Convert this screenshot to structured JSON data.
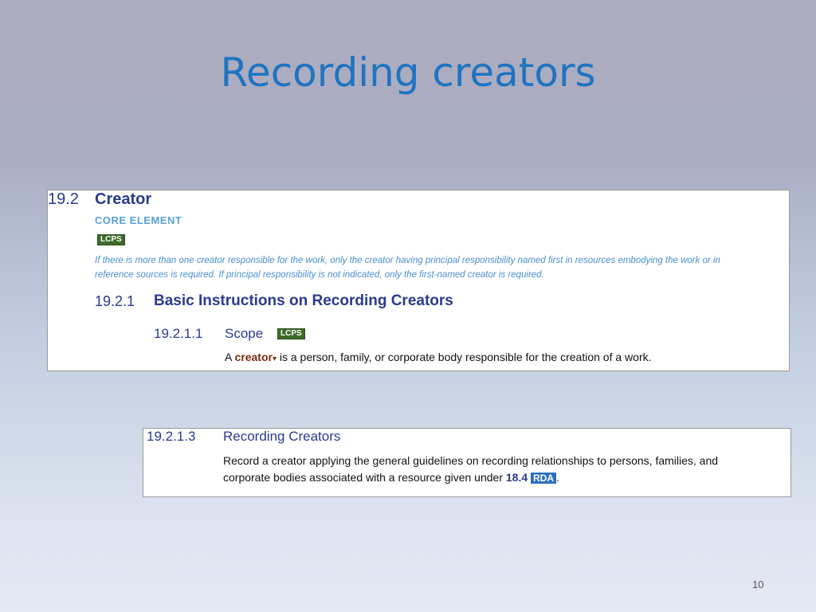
{
  "slide": {
    "title": "Recording creators",
    "number": "10"
  },
  "panel1": {
    "section_num": "19.2",
    "section_title": "Creator",
    "core_label": "CORE ELEMENT",
    "lcps_badge": "LCPS",
    "note_line1": "If there is more than one creator responsible for the work, only the creator having principal responsibility named first in resources embodying the work or in",
    "note_line2": "reference sources is required. If principal responsibility is not indicated, only the first-named creator is required.",
    "sub_num": "19.2.1",
    "sub_title": "Basic Instructions on Recording Creators",
    "subsub_num": "19.2.1.1",
    "subsub_title": "Scope",
    "subsub_badge": "LCPS",
    "def_prefix": "A ",
    "def_term": "creator",
    "def_caret": "▾",
    "def_rest": " is a person, family, or corporate body responsible for the creation of a work."
  },
  "panel2": {
    "num": "19.2.1.3",
    "title": "Recording Creators",
    "line1": "Record a creator applying the general guidelines on recording relationships to persons, families, and",
    "line2_prefix": "corporate bodies associated with a resource given under ",
    "ref_num": "18.4",
    "rda_badge": "RDA",
    "line2_suffix": "."
  },
  "colors": {
    "title": "#1f74c0",
    "heading": "#2b3a8e",
    "core": "#5aa0d6",
    "lcps": "#3e6b2a",
    "rda": "#2a6fc0"
  }
}
